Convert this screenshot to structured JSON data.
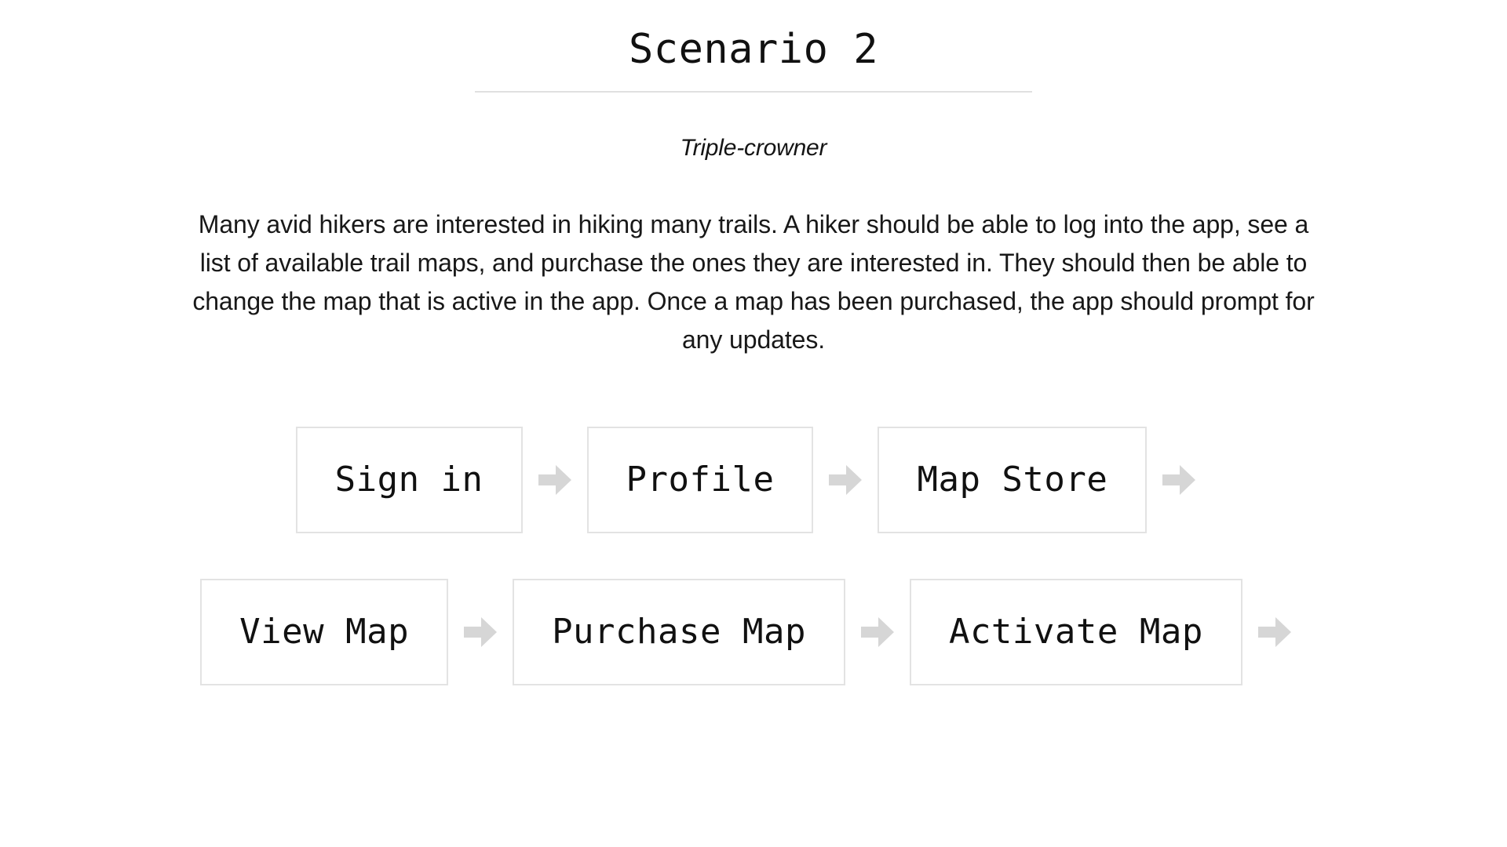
{
  "header": {
    "title": "Scenario 2",
    "divider": true
  },
  "subtitle": "Triple-crowner",
  "description": "Many avid hikers are interested in hiking many trails. A hiker should be able to log into the app, see a list of available trail maps, and purchase the ones they are interested in. They should then be able to change the map that is active in the app. Once a map has been purchased, the app should prompt for any updates.",
  "flow": {
    "arrow_icon": "arrow-right-icon",
    "arrow_color": "#d6d6d6",
    "box_border_color": "#e3e3e3",
    "steps": [
      {
        "label": "Sign in"
      },
      {
        "label": "Profile"
      },
      {
        "label": "Map Store"
      },
      {
        "label": "View Map"
      },
      {
        "label": "Purchase Map"
      },
      {
        "label": "Activate Map"
      }
    ]
  }
}
